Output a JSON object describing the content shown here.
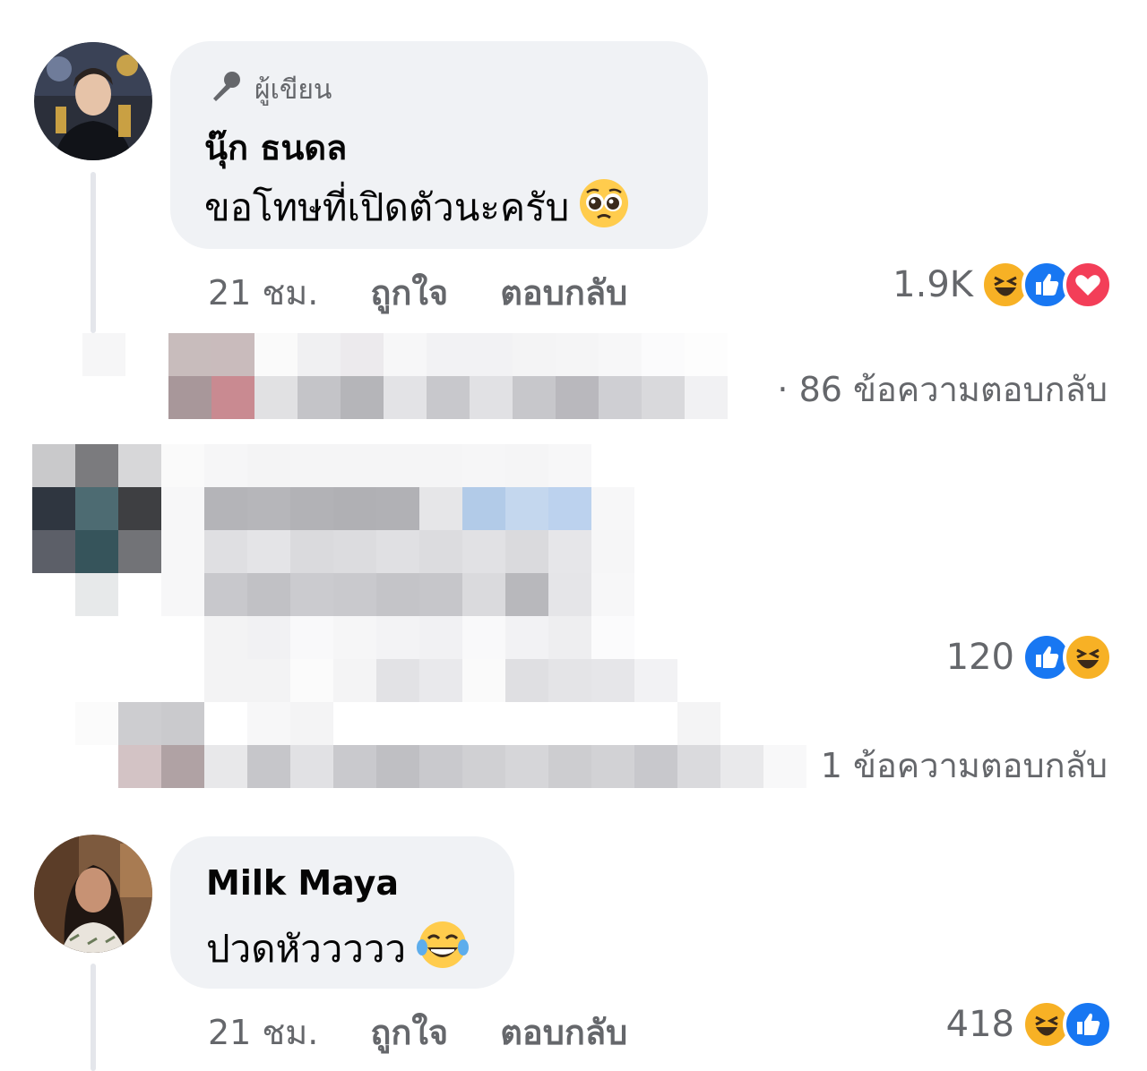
{
  "comments": [
    {
      "author_badge": "ผู้เขียน",
      "name": "นุ๊ก ธนดล",
      "text": "ขอโทษที่เปิดตัวนะครับ",
      "time": "21 ชม.",
      "like_label": "ถูกใจ",
      "reply_label": "ตอบกลับ",
      "reaction_count": "1.9K",
      "reactions": [
        "haha-icon",
        "like-icon",
        "love-icon"
      ],
      "replies_link": "· 86 ข้อความตอบกลับ"
    },
    {
      "reaction_count": "120",
      "reactions": [
        "like-icon",
        "haha-icon"
      ],
      "replies_link": "1 ข้อความตอบกลับ"
    },
    {
      "name": "Milk Maya",
      "text": "ปวดหัววววว",
      "time": "21 ชม.",
      "like_label": "ถูกใจ",
      "reply_label": "ตอบกลับ",
      "reaction_count": "418",
      "reactions": [
        "haha-icon",
        "like-icon"
      ]
    }
  ],
  "colors": {
    "like": "#1877f2",
    "love": "#f33e58",
    "haha": "#f7b125",
    "secondary_text": "#65676b",
    "bubble": "#f0f2f5"
  }
}
